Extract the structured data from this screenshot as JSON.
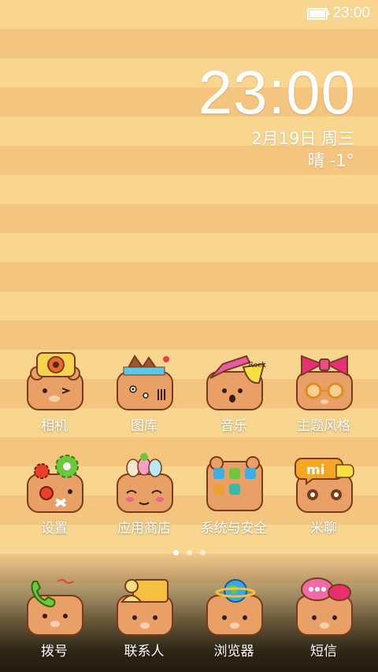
{
  "status_bar": {
    "time": "23:00",
    "battery_icon": "battery-icon"
  },
  "lockclock": {
    "time": "23:00",
    "date": "2月19日 周三",
    "weather": "晴  -1°"
  },
  "apps": [
    {
      "label": "相机",
      "icon": "camera-icon"
    },
    {
      "label": "图库",
      "icon": "gallery-icon"
    },
    {
      "label": "音乐",
      "icon": "music-icon"
    },
    {
      "label": "主题风格",
      "icon": "themes-icon"
    },
    {
      "label": "设置",
      "icon": "settings-icon"
    },
    {
      "label": "应用商店",
      "icon": "app-store-icon"
    },
    {
      "label": "系统与安全",
      "icon": "system-security-icon"
    },
    {
      "label": "米聊",
      "icon": "miliao-icon"
    }
  ],
  "dock": [
    {
      "label": "拨号",
      "icon": "phone-icon"
    },
    {
      "label": "联系人",
      "icon": "contacts-icon"
    },
    {
      "label": "浏览器",
      "icon": "browser-icon"
    },
    {
      "label": "短信",
      "icon": "messages-icon"
    }
  ],
  "pager": {
    "pages": 3,
    "current": 1
  },
  "colors": {
    "stripe_light": "#f8d690",
    "stripe_dark": "#f4c57f",
    "bear_body": "#e8a067",
    "bear_outline": "#7a3b1a",
    "text": "#ffffff"
  }
}
